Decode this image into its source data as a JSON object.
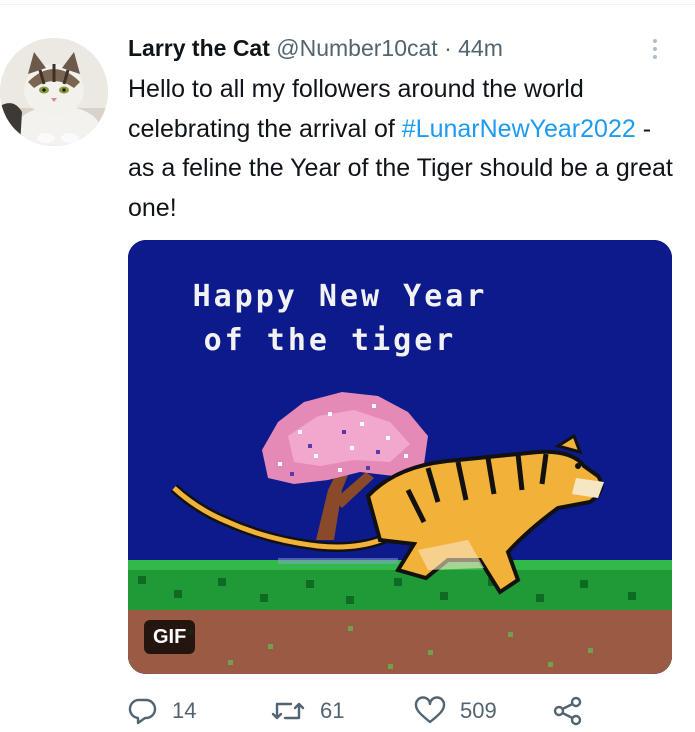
{
  "tweet": {
    "author_name": "Larry the Cat",
    "handle": "@Number10cat",
    "separator": "·",
    "time": "44m",
    "text_before": "Hello to all my followers around the world celebrating the arrival of ",
    "hashtag": "#LunarNewYear2022",
    "text_after": " - as a feline the Year of the Tiger should be a great one!"
  },
  "media": {
    "line1": "Happy New Year",
    "line2": "of the tiger",
    "badge": "GIF"
  },
  "actions": {
    "replies": "14",
    "retweets": "61",
    "likes": "509"
  },
  "icons": {
    "more": "more-vertical-icon",
    "reply": "reply-icon",
    "retweet": "retweet-icon",
    "like": "heart-icon",
    "share": "share-icon"
  },
  "colors": {
    "accent": "#1d9bf0",
    "text": "#0f1419",
    "secondary": "#536471",
    "sky": "#0c1a8c"
  }
}
